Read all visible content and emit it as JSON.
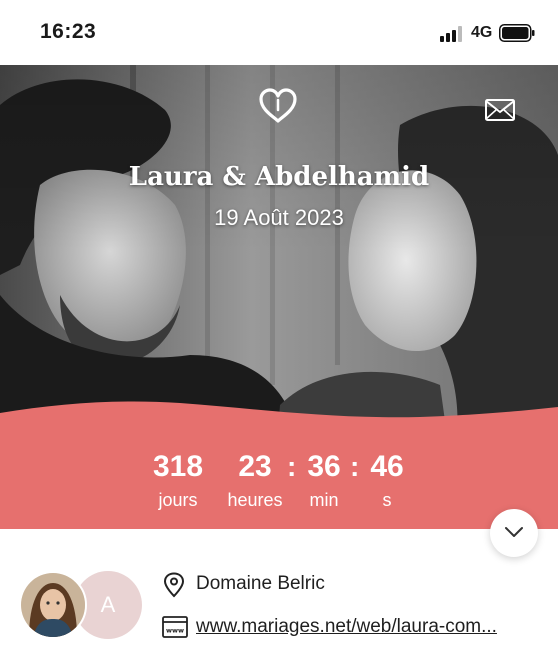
{
  "status_bar": {
    "time": "16:23",
    "network": "4G"
  },
  "hero": {
    "couple_names": "Laura & Abdelhamid",
    "date": "19 Août 2023",
    "icons": [
      "heart-icon",
      "mail-icon"
    ]
  },
  "countdown": {
    "days_value": "318",
    "days_label": "jours",
    "hours_value": "23",
    "hours_label": "heures",
    "minutes_value": "36",
    "minutes_label": "min",
    "seconds_value": "46",
    "seconds_label": "s",
    "separator": ":",
    "band_color": "#E6706E"
  },
  "profile": {
    "avatar_initial": "A"
  },
  "info": {
    "venue": "Domaine Belric",
    "website": "www.mariages.net/web/laura-com..."
  }
}
